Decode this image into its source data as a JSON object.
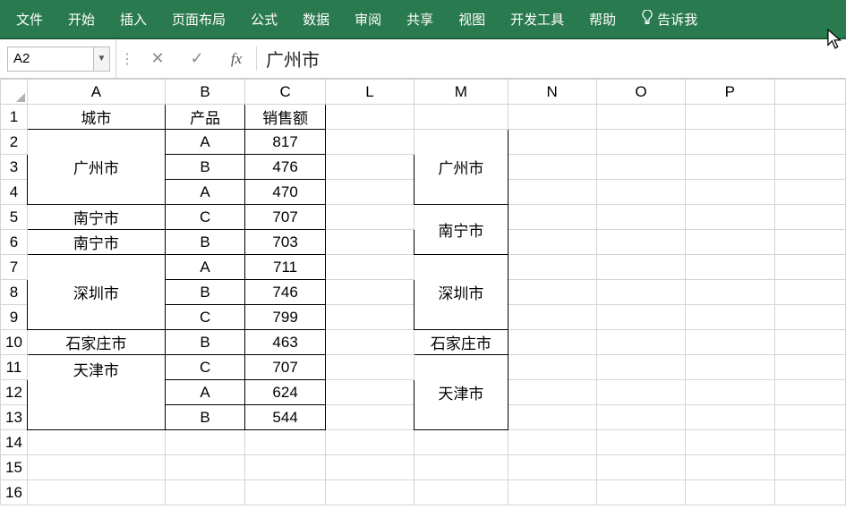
{
  "ribbon": {
    "items": [
      "文件",
      "开始",
      "插入",
      "页面布局",
      "公式",
      "数据",
      "审阅",
      "共享",
      "视图",
      "开发工具",
      "帮助"
    ],
    "tell_me": "告诉我"
  },
  "formula_bar": {
    "name_box": "A2",
    "cancel": "✕",
    "enter": "✓",
    "fx": "fx",
    "value": "广州市"
  },
  "columns": [
    "A",
    "B",
    "C",
    "L",
    "M",
    "N",
    "O",
    "P"
  ],
  "row_numbers": [
    "1",
    "2",
    "3",
    "4",
    "5",
    "6",
    "7",
    "8",
    "9",
    "10",
    "11",
    "12",
    "13",
    "14",
    "15",
    "16"
  ],
  "headers": {
    "A": "城市",
    "B": "产品",
    "C": "销售额"
  },
  "table_rows": [
    {
      "city": "广州市",
      "citySpan": 3,
      "hl": true,
      "prod": "A",
      "val": "817"
    },
    {
      "city": null,
      "hl": true,
      "prod": "B",
      "val": "476"
    },
    {
      "city": null,
      "hl": true,
      "prod": "A",
      "val": "470"
    },
    {
      "city": "南宁市",
      "citySpan": 1,
      "hl": false,
      "prod": "C",
      "val": "707"
    },
    {
      "city": "南宁市",
      "citySpan": 1,
      "hl": false,
      "prod": "B",
      "val": "703"
    },
    {
      "city": "深圳市",
      "citySpan": 3,
      "hl": true,
      "prod": "A",
      "val": "711",
      "hlBC": true
    },
    {
      "city": null,
      "hl": true,
      "prod": "B",
      "val": "746",
      "hlBC": true
    },
    {
      "city": null,
      "hl": false,
      "prod": "C",
      "val": "799"
    },
    {
      "city": "石家庄市",
      "citySpan": 1,
      "hl": false,
      "prod": "B",
      "val": "463"
    },
    {
      "city": "天津市",
      "citySpan": 3,
      "hl": false,
      "prod": "C",
      "val": "707",
      "cityTop": true
    },
    {
      "city": null,
      "hl": false,
      "prod": "A",
      "val": "624"
    },
    {
      "city": null,
      "hl": false,
      "prod": "B",
      "val": "544"
    }
  ],
  "m_column": [
    {
      "label": "广州市",
      "span": 3,
      "hl": true
    },
    {
      "label": "南宁市",
      "span": 2,
      "hl": true
    },
    {
      "label": "深圳市",
      "span": 3,
      "hl": true
    },
    {
      "label": "石家庄市",
      "span": 1,
      "hl": false
    },
    {
      "label": "天津市",
      "span": 3,
      "hl": false
    }
  ]
}
